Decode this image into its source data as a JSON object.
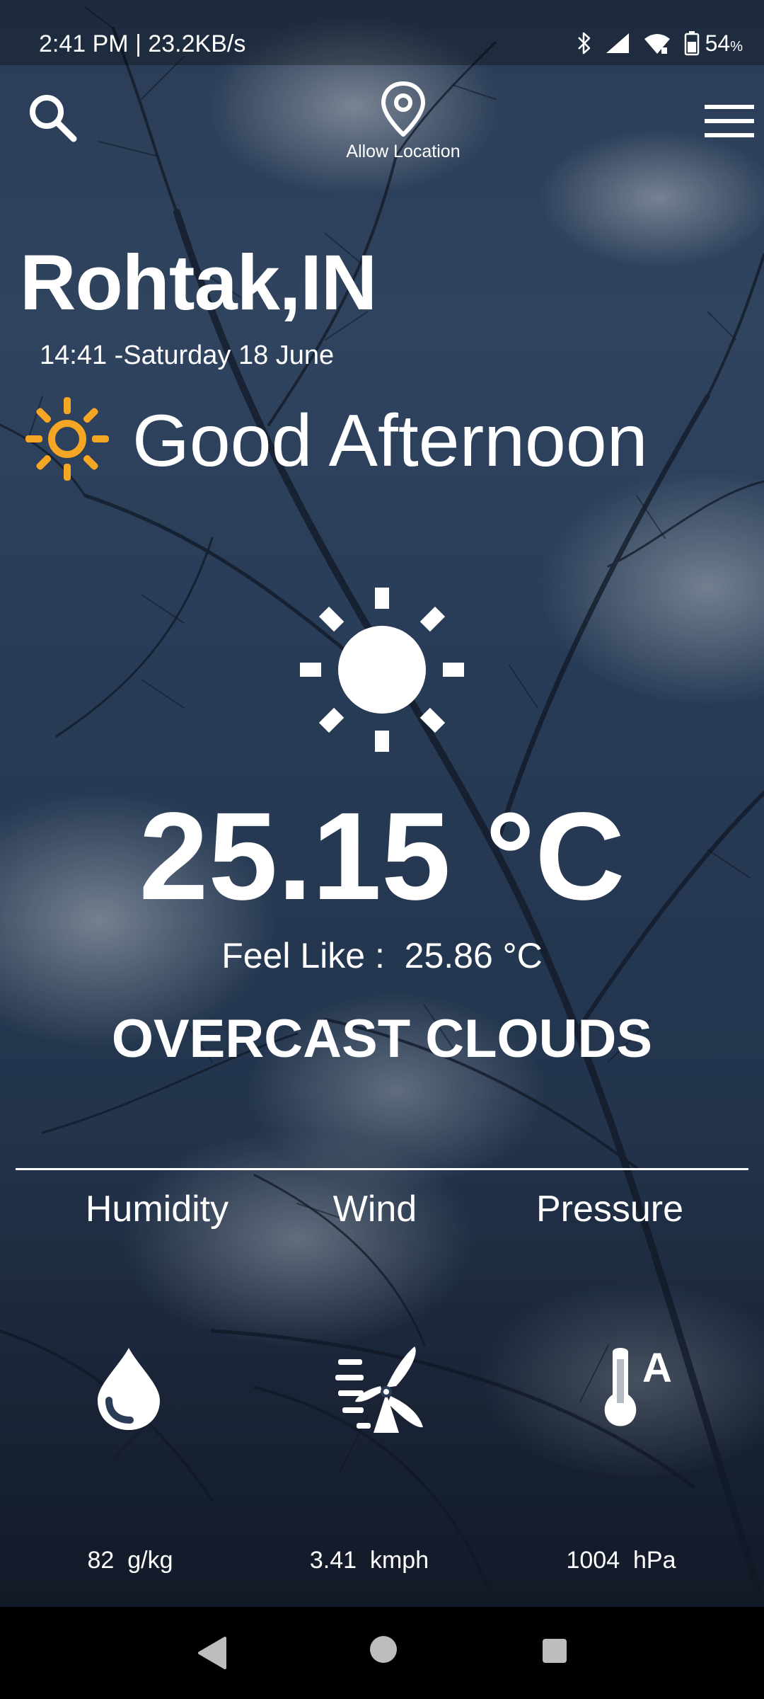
{
  "status_bar": {
    "time": "2:41 PM | 23.2KB/s",
    "battery_percent": "54",
    "battery_unit": "%",
    "icons": [
      "bluetooth-icon",
      "cellular-signal-icon",
      "wifi-icon",
      "battery-icon"
    ]
  },
  "top_bar": {
    "search_icon": "search-icon",
    "location_icon": "map-pin-icon",
    "location_label": "Allow Location",
    "menu_icon": "hamburger-menu-icon"
  },
  "location": {
    "city": "Rohtak,IN",
    "time": "14:41",
    "date": "-Saturday 18 June"
  },
  "greeting": {
    "icon": "sun-icon",
    "icon_color": "#F5A623",
    "text": "Good Afternoon"
  },
  "weather": {
    "icon": "sun-icon",
    "temperature": "25.15 °C",
    "feels_like_label": "Feel Like :",
    "feels_like_value": "25.86 °C",
    "condition": "OVERCAST CLOUDS"
  },
  "stats": {
    "humidity": {
      "label": "Humidity",
      "icon": "water-drop-icon",
      "value": "82",
      "unit": "g/kg"
    },
    "wind": {
      "label": "Wind",
      "icon": "wind-turbine-icon",
      "value": "3.41",
      "unit": "kmph"
    },
    "pressure": {
      "label": "Pressure",
      "icon": "thermometer-icon",
      "value": "1004",
      "unit": "hPa"
    }
  },
  "nav_bar": {
    "back_icon": "back-triangle-icon",
    "home_icon": "home-circle-icon",
    "recents_icon": "recents-square-icon"
  },
  "colors": {
    "text": "#FFFFFF",
    "accent_sun": "#F5A623",
    "nav_background": "#000000"
  }
}
